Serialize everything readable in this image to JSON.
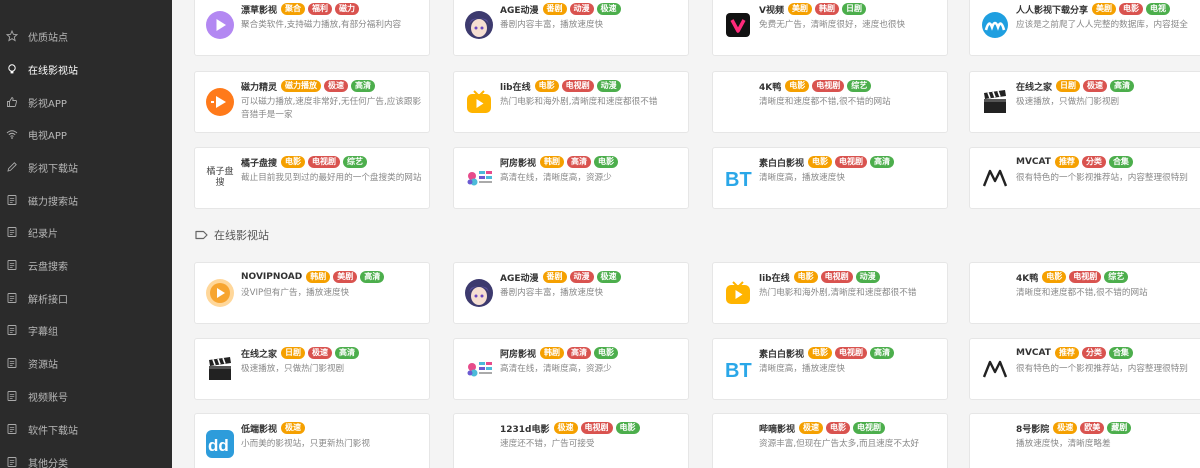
{
  "colors": {
    "sidebar_bg": "#2b2b2b",
    "badge_orange": "#f5a000",
    "badge_red": "#d9534f",
    "badge_green": "#4cae4c"
  },
  "sidebar": {
    "items": [
      {
        "label": "优质站点",
        "icon": "star-icon",
        "active": false
      },
      {
        "label": "在线影视站",
        "icon": "bulb-icon",
        "active": true
      },
      {
        "label": "影视APP",
        "icon": "thumb-icon",
        "active": false
      },
      {
        "label": "电视APP",
        "icon": "wifi-icon",
        "active": false
      },
      {
        "label": "影视下载站",
        "icon": "pencil-icon",
        "active": false
      },
      {
        "label": "磁力搜索站",
        "icon": "doc-icon",
        "active": false
      },
      {
        "label": "纪录片",
        "icon": "doc-icon",
        "active": false
      },
      {
        "label": "云盘搜索",
        "icon": "doc-icon",
        "active": false
      },
      {
        "label": "解析接口",
        "icon": "doc-icon",
        "active": false
      },
      {
        "label": "字幕组",
        "icon": "doc-icon",
        "active": false
      },
      {
        "label": "资源站",
        "icon": "doc-icon",
        "active": false
      },
      {
        "label": "视频账号",
        "icon": "doc-icon",
        "active": false
      },
      {
        "label": "软件下载站",
        "icon": "doc-icon",
        "active": false
      },
      {
        "label": "其他分类",
        "icon": "doc-icon",
        "active": false
      }
    ]
  },
  "section": {
    "title": "在线影视站",
    "icon": "tag-icon"
  },
  "cards": [
    {
      "name": "漂草影视",
      "logo": "purple-play-logo",
      "badges": [
        {
          "t": "聚合",
          "c": "orange"
        },
        {
          "t": "福利",
          "c": "red"
        },
        {
          "t": "磁力",
          "c": "red"
        }
      ],
      "desc": "聚合类软件,支持磁力播放,有部分福利内容"
    },
    {
      "name": "AGE动漫",
      "logo": "anime-avatar-logo",
      "badges": [
        {
          "t": "番剧",
          "c": "orange"
        },
        {
          "t": "动漫",
          "c": "red"
        },
        {
          "t": "极速",
          "c": "green"
        }
      ],
      "desc": "番剧内容丰富，播放速度快"
    },
    {
      "name": "V视频",
      "logo": "v-video-logo",
      "badges": [
        {
          "t": "美剧",
          "c": "orange"
        },
        {
          "t": "韩剧",
          "c": "red"
        },
        {
          "t": "日剧",
          "c": "green"
        }
      ],
      "desc": "免费无广告，清晰度很好，速度也很快"
    },
    {
      "name": "人人影视下载分享",
      "logo": "rr-logo",
      "badges": [
        {
          "t": "美剧",
          "c": "orange"
        },
        {
          "t": "电影",
          "c": "red"
        },
        {
          "t": "电视",
          "c": "green"
        }
      ],
      "desc": "应该是之前爬了人人完整的数据库，内容挺全"
    },
    {
      "name": "磁力精灵",
      "logo": "orange-play-logo",
      "badges": [
        {
          "t": "磁力播放",
          "c": "orange"
        },
        {
          "t": "极速",
          "c": "red"
        },
        {
          "t": "高清",
          "c": "green"
        }
      ],
      "desc": "可以磁力播放,速度非常好,无任何广告,应该跟影音猎手是一家"
    },
    {
      "name": "lib在线",
      "logo": "yellow-tv-logo",
      "badges": [
        {
          "t": "电影",
          "c": "orange"
        },
        {
          "t": "电视剧",
          "c": "red"
        },
        {
          "t": "动漫",
          "c": "green"
        }
      ],
      "desc": "热门电影和海外剧,清晰度和速度都很不错"
    },
    {
      "name": "4K鸭",
      "logo": "blank-logo",
      "badges": [
        {
          "t": "电影",
          "c": "orange"
        },
        {
          "t": "电视剧",
          "c": "red"
        },
        {
          "t": "综艺",
          "c": "green"
        }
      ],
      "desc": "清晰度和速度都不错,很不错的网站"
    },
    {
      "name": "在线之家",
      "logo": "clapper-logo",
      "badges": [
        {
          "t": "日剧",
          "c": "orange"
        },
        {
          "t": "极速",
          "c": "red"
        },
        {
          "t": "高清",
          "c": "green"
        }
      ],
      "desc": "极速播放，只做热门影视剧"
    },
    {
      "name": "橘子盘搜",
      "logo": "broken-logo",
      "logo_text": "橘子盘搜",
      "badges": [
        {
          "t": "电影",
          "c": "orange"
        },
        {
          "t": "电视剧",
          "c": "red"
        },
        {
          "t": "综艺",
          "c": "green"
        }
      ],
      "desc": "截止目前我见到过的最好用的一个盘搜类的网站"
    },
    {
      "name": "阿房影视",
      "logo": "afang-logo",
      "badges": [
        {
          "t": "韩剧",
          "c": "orange"
        },
        {
          "t": "高清",
          "c": "red"
        },
        {
          "t": "电影",
          "c": "green"
        }
      ],
      "desc": "高清在线，清晰度高，资源少"
    },
    {
      "name": "素白白影视",
      "logo": "bt-logo",
      "badges": [
        {
          "t": "电影",
          "c": "orange"
        },
        {
          "t": "电视剧",
          "c": "red"
        },
        {
          "t": "高清",
          "c": "green"
        }
      ],
      "desc": "清晰度高，播放速度快"
    },
    {
      "name": "MVCAT",
      "logo": "mvcat-logo",
      "badges": [
        {
          "t": "推荐",
          "c": "orange"
        },
        {
          "t": "分类",
          "c": "red"
        },
        {
          "t": "合集",
          "c": "green"
        }
      ],
      "desc": "很有特色的一个影视推荐站，内容整理很特别"
    },
    {
      "name": "NOVIPNOAD",
      "logo": "novip-logo",
      "badges": [
        {
          "t": "韩剧",
          "c": "orange"
        },
        {
          "t": "美剧",
          "c": "red"
        },
        {
          "t": "高清",
          "c": "green"
        }
      ],
      "desc": "没VIP但有广告，播放速度快"
    },
    {
      "name": "AGE动漫",
      "logo": "anime-avatar-logo",
      "badges": [
        {
          "t": "番剧",
          "c": "orange"
        },
        {
          "t": "动漫",
          "c": "red"
        },
        {
          "t": "极速",
          "c": "green"
        }
      ],
      "desc": "番剧内容丰富，播放速度快"
    },
    {
      "name": "lib在线",
      "logo": "yellow-tv-logo",
      "badges": [
        {
          "t": "电影",
          "c": "orange"
        },
        {
          "t": "电视剧",
          "c": "red"
        },
        {
          "t": "动漫",
          "c": "green"
        }
      ],
      "desc": "热门电影和海外剧,清晰度和速度都很不错"
    },
    {
      "name": "4K鸭",
      "logo": "blank-logo",
      "badges": [
        {
          "t": "电影",
          "c": "orange"
        },
        {
          "t": "电视剧",
          "c": "red"
        },
        {
          "t": "综艺",
          "c": "green"
        }
      ],
      "desc": "清晰度和速度都不错,很不错的网站"
    },
    {
      "name": "在线之家",
      "logo": "clapper-logo",
      "badges": [
        {
          "t": "日剧",
          "c": "orange"
        },
        {
          "t": "极速",
          "c": "red"
        },
        {
          "t": "高清",
          "c": "green"
        }
      ],
      "desc": "极速播放，只做热门影视剧"
    },
    {
      "name": "阿房影视",
      "logo": "afang-logo",
      "badges": [
        {
          "t": "韩剧",
          "c": "orange"
        },
        {
          "t": "高清",
          "c": "red"
        },
        {
          "t": "电影",
          "c": "green"
        }
      ],
      "desc": "高清在线，清晰度高，资源少"
    },
    {
      "name": "素白白影视",
      "logo": "bt-logo",
      "badges": [
        {
          "t": "电影",
          "c": "orange"
        },
        {
          "t": "电视剧",
          "c": "red"
        },
        {
          "t": "高清",
          "c": "green"
        }
      ],
      "desc": "清晰度高，播放速度快"
    },
    {
      "name": "MVCAT",
      "logo": "mvcat-logo",
      "badges": [
        {
          "t": "推荐",
          "c": "orange"
        },
        {
          "t": "分类",
          "c": "red"
        },
        {
          "t": "合集",
          "c": "green"
        }
      ],
      "desc": "很有特色的一个影视推荐站，内容整理很特别"
    },
    {
      "name": "低端影视",
      "logo": "dd-logo",
      "badges": [
        {
          "t": "极速",
          "c": "orange"
        }
      ],
      "desc": "小而美的影视站，只更新热门影视"
    },
    {
      "name": "1231d电影",
      "logo": "blank-logo",
      "badges": [
        {
          "t": "极速",
          "c": "orange"
        },
        {
          "t": "电视剧",
          "c": "red"
        },
        {
          "t": "电影",
          "c": "green"
        }
      ],
      "desc": "速度还不错，广告可接受"
    },
    {
      "name": "哔嘀影视",
      "logo": "blank-logo",
      "badges": [
        {
          "t": "极速",
          "c": "orange"
        },
        {
          "t": "电影",
          "c": "red"
        },
        {
          "t": "电视剧",
          "c": "green"
        }
      ],
      "desc": "资源丰富,但现在广告太多,而且速度不太好"
    },
    {
      "name": "8号影院",
      "logo": "blank-logo",
      "badges": [
        {
          "t": "极速",
          "c": "orange"
        },
        {
          "t": "欧美",
          "c": "red"
        },
        {
          "t": "藏剧",
          "c": "green"
        }
      ],
      "desc": "播放速度快，清晰度略差"
    }
  ]
}
